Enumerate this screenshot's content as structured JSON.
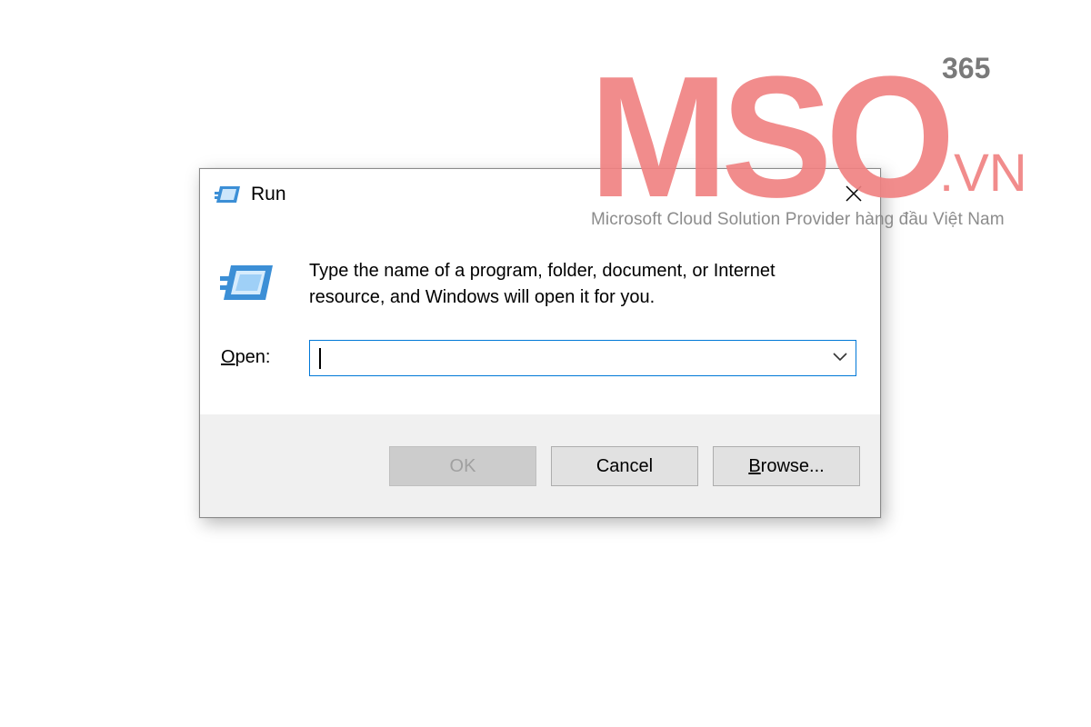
{
  "dialog": {
    "title": "Run",
    "description": "Type the name of a program, folder, document, or Internet resource, and Windows will open it for you.",
    "open_label_accesskey": "O",
    "open_label_rest": "pen:",
    "open_input_value": "",
    "buttons": {
      "ok": "OK",
      "cancel": "Cancel",
      "browse_accesskey": "B",
      "browse_rest": "rowse..."
    }
  },
  "watermark": {
    "brand": "MSO",
    "superscript": "365",
    "suffix": ".VN",
    "tagline": "Microsoft Cloud Solution Provider hàng đầu Việt Nam"
  },
  "icons": {
    "run": "run-app-icon",
    "close": "close-icon",
    "dropdown": "chevron-down-icon"
  },
  "colors": {
    "accent_border": "#0078d7",
    "logo_pink": "#f08080",
    "logo_gray": "#7a7a7a",
    "button_face": "#e1e1e1",
    "button_disabled": "#cccccc"
  }
}
